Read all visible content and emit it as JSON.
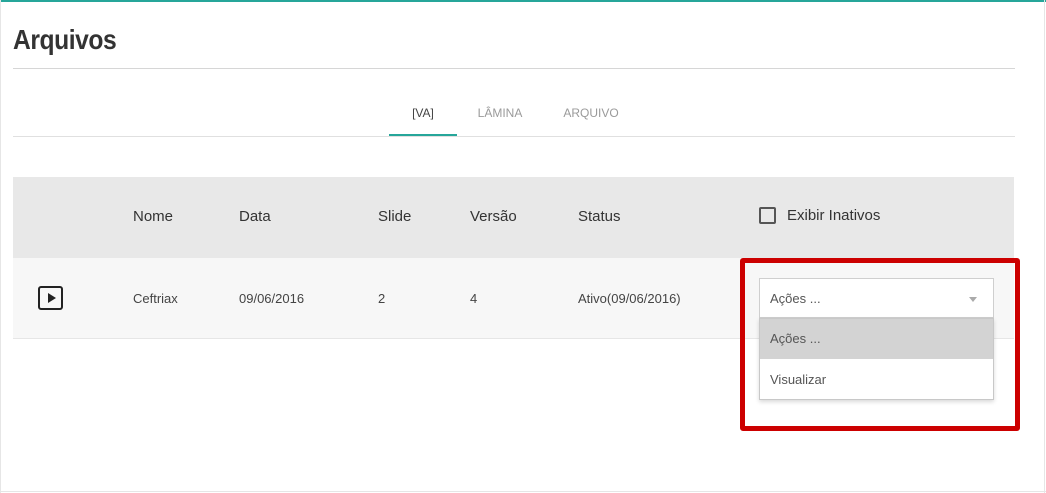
{
  "page": {
    "title": "Arquivos"
  },
  "tabs": [
    {
      "label": "[VA]",
      "active": true
    },
    {
      "label": "LÂMINA",
      "active": false
    },
    {
      "label": "ARQUIVO",
      "active": false
    }
  ],
  "table": {
    "headers": {
      "nome": "Nome",
      "data": "Data",
      "slide": "Slide",
      "versao": "Versão",
      "status": "Status"
    },
    "show_inactive_label": "Exibir Inativos",
    "rows": [
      {
        "nome": "Ceftriax",
        "data": "09/06/2016",
        "slide": "2",
        "versao": "4",
        "status": "Ativo(09/06/2016)",
        "icon": "play-icon"
      }
    ]
  },
  "actions_select": {
    "value": "Ações ...",
    "options": [
      "Ações ...",
      "Visualizar"
    ]
  },
  "colors": {
    "accent": "#26a69a",
    "highlight": "#cc0000",
    "header_bg": "#e8e8e8"
  }
}
